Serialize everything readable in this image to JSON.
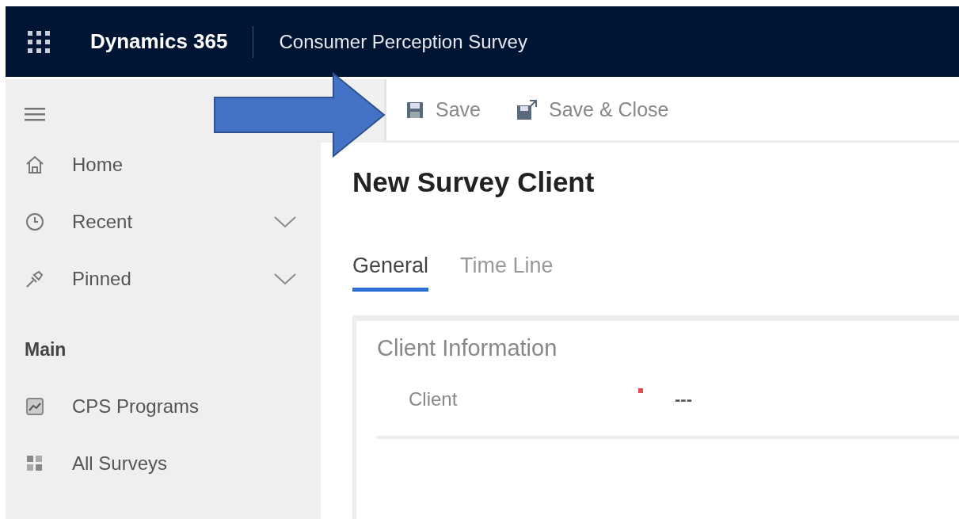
{
  "header": {
    "app_name": "Dynamics 365",
    "area_name": "Consumer Perception Survey"
  },
  "sidebar": {
    "items": [
      {
        "label": "Home",
        "kind": "home",
        "expandable": false
      },
      {
        "label": "Recent",
        "kind": "clock",
        "expandable": true
      },
      {
        "label": "Pinned",
        "kind": "pin",
        "expandable": true
      }
    ],
    "group_title": "Main",
    "group_items": [
      {
        "label": "CPS Programs",
        "kind": "chart"
      },
      {
        "label": "All Surveys",
        "kind": "grid"
      }
    ]
  },
  "toolbar": {
    "buttons": [
      {
        "label": "Save",
        "kind": "save"
      },
      {
        "label": "Save & Close",
        "kind": "saveclose"
      }
    ]
  },
  "form": {
    "title": "New Survey Client",
    "tabs": [
      {
        "label": "General",
        "selected": true
      },
      {
        "label": "Time Line",
        "selected": false
      }
    ],
    "section": {
      "title": "Client Information",
      "fields": [
        {
          "label": "Client",
          "required": true,
          "value": "---"
        }
      ]
    }
  }
}
